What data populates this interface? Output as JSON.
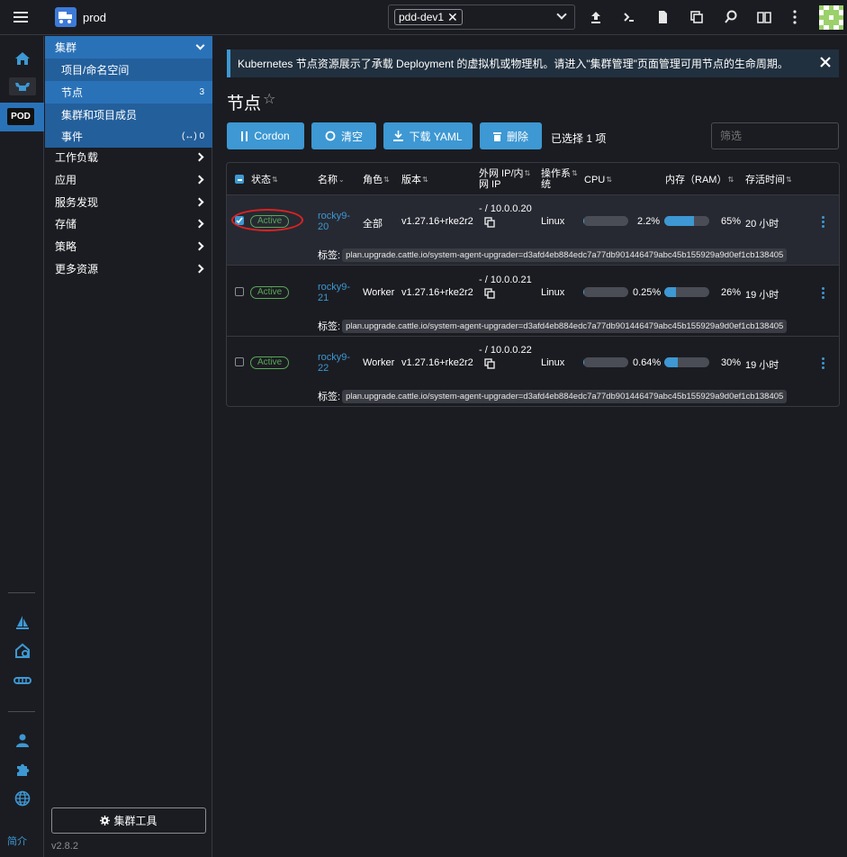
{
  "header": {
    "cluster_name": "prod",
    "namespace_chip": "pdd-dev1"
  },
  "rail": {
    "pod_label": "POD",
    "bottom_label": "简介"
  },
  "sidenav": {
    "group_label": "集群",
    "sub_items": [
      {
        "label": "项目/命名空间",
        "count": ""
      },
      {
        "label": "节点",
        "count": "3"
      },
      {
        "label": "集群和项目成员",
        "count": ""
      },
      {
        "label": "事件",
        "count": "(↔) 0"
      }
    ],
    "items": [
      "工作负载",
      "应用",
      "服务发现",
      "存储",
      "策略",
      "更多资源"
    ],
    "tools_button": "集群工具",
    "version": "v2.8.2"
  },
  "banner": {
    "text": "Kubernetes 节点资源展示了承载 Deployment 的虚拟机或物理机。请进入\"集群管理\"页面管理可用节点的生命周期。"
  },
  "page": {
    "title": "节点",
    "buttons": {
      "cordon": "Cordon",
      "drain": "清空",
      "download": "下载 YAML",
      "delete": "删除"
    },
    "selected_text": "已选择 1 项",
    "filter_placeholder": "筛选"
  },
  "table": {
    "headers": {
      "state": "状态",
      "name": "名称",
      "role": "角色",
      "version": "版本",
      "ip_line1": "外网 IP/内",
      "ip_line2": "网 IP",
      "os_line1": "操作系",
      "os_line2": "统",
      "cpu": "CPU",
      "ram": "内存（RAM）",
      "age": "存活时间"
    },
    "label_prefix": "标签:",
    "rows": [
      {
        "state": "Active",
        "name_line1": "rocky9-",
        "name_line2": "20",
        "role": "全部",
        "version": "v1.27.16+rke2r2",
        "ip": "- / 10.0.0.20",
        "os": "Linux",
        "cpu_pct": 2.2,
        "cpu_text": "2.2%",
        "ram_pct": 65,
        "ram_text": "65%",
        "age": "20 小时",
        "label": "plan.upgrade.cattle.io/system-agent-upgrader=d3afd4eb884edc7a77db901446479abc45b155929a9d0ef1cb138405",
        "selected": true
      },
      {
        "state": "Active",
        "name_line1": "rocky9-",
        "name_line2": "21",
        "role": "Worker",
        "version": "v1.27.16+rke2r2",
        "ip": "- / 10.0.0.21",
        "os": "Linux",
        "cpu_pct": 0.25,
        "cpu_text": "0.25%",
        "ram_pct": 26,
        "ram_text": "26%",
        "age": "19 小时",
        "label": "plan.upgrade.cattle.io/system-agent-upgrader=d3afd4eb884edc7a77db901446479abc45b155929a9d0ef1cb138405",
        "selected": false
      },
      {
        "state": "Active",
        "name_line1": "rocky9-",
        "name_line2": "22",
        "role": "Worker",
        "version": "v1.27.16+rke2r2",
        "ip": "- / 10.0.0.22",
        "os": "Linux",
        "cpu_pct": 0.64,
        "cpu_text": "0.64%",
        "ram_pct": 30,
        "ram_text": "30%",
        "age": "19 小时",
        "label": "plan.upgrade.cattle.io/system-agent-upgrader=d3afd4eb884edc7a77db901446479abc45b155929a9d0ef1cb138405",
        "selected": false
      }
    ]
  },
  "colors": {
    "accent": "#3d98d3",
    "nav_active": "#2a72b8",
    "active_badge": "#5aa75a",
    "annotation_circle": "#dd2222"
  }
}
